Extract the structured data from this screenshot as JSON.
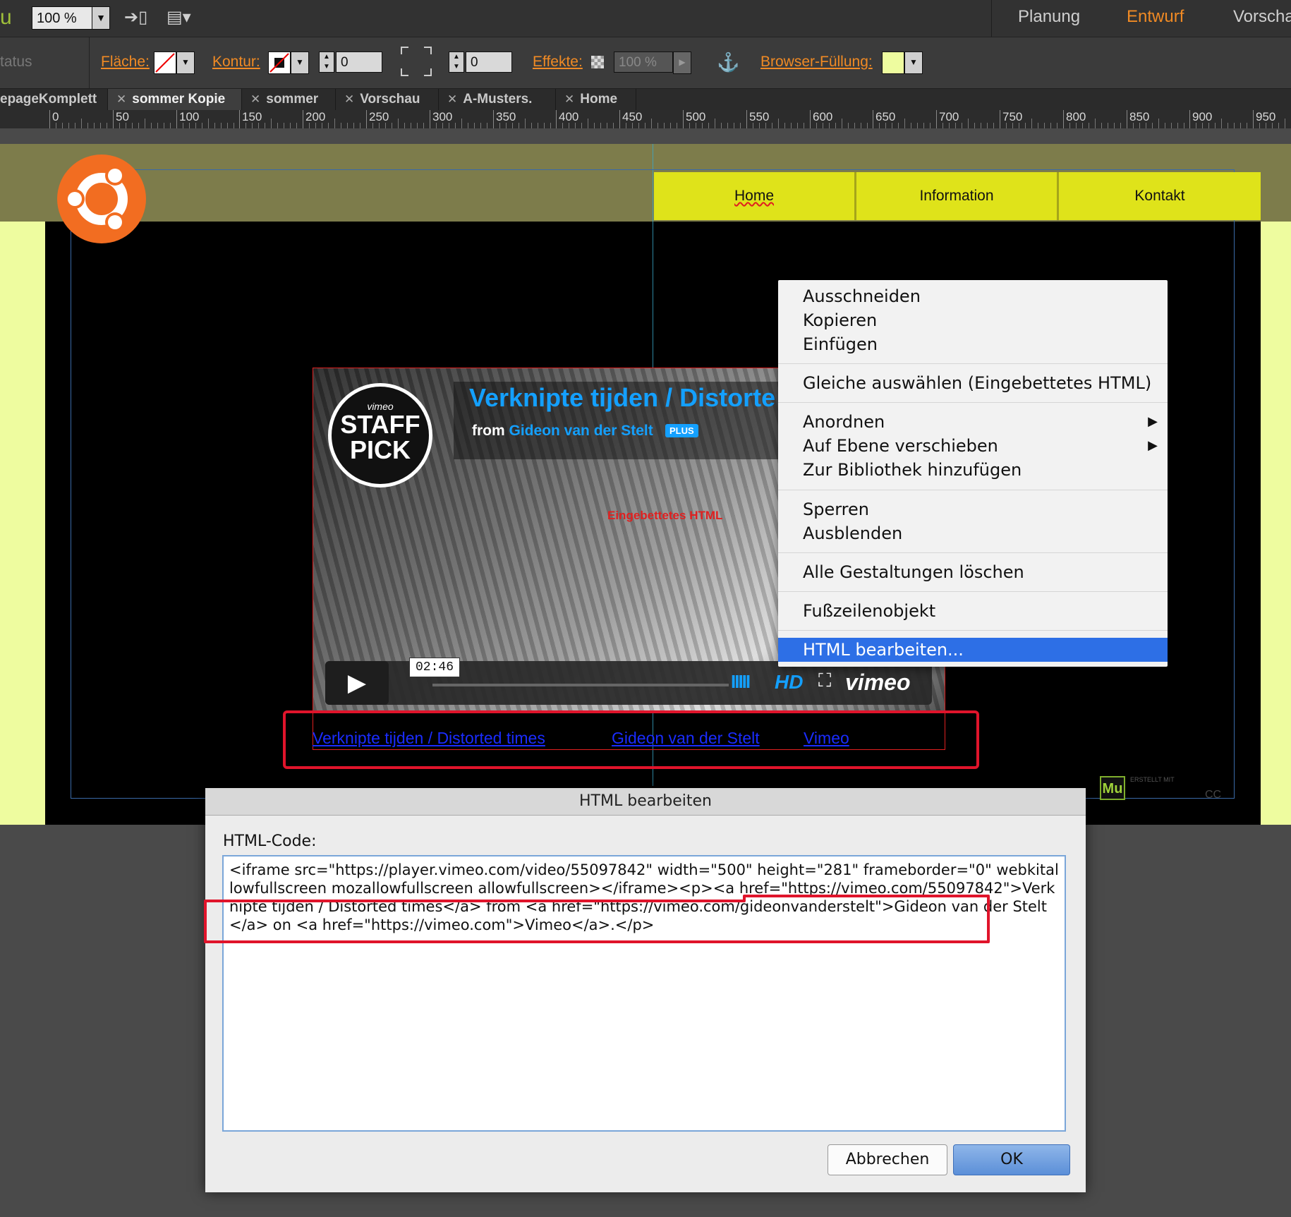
{
  "toolbar": {
    "zoom_value": "100 %",
    "modes": [
      "Planung",
      "Entwurf",
      "Vorscha"
    ],
    "active_mode": "Entwurf"
  },
  "controls": {
    "status_label": "tatus",
    "fill_label": "Fläche:",
    "stroke_label": "Kontur:",
    "stroke_width": "0",
    "corner_value": "0",
    "effects_label": "Effekte:",
    "opacity_value": "100 %",
    "browser_fill_label": "Browser-Füllung:",
    "browser_fill_color": "#eefc9f"
  },
  "tabs": [
    {
      "label": "epageKomplett",
      "closable": false
    },
    {
      "label": "sommer Kopie",
      "closable": true,
      "active": true
    },
    {
      "label": "sommer",
      "closable": true
    },
    {
      "label": "Vorschau",
      "closable": true
    },
    {
      "label": "A-Musters.",
      "closable": true
    },
    {
      "label": "Home",
      "closable": true
    }
  ],
  "ruler": [
    "0",
    "50",
    "100",
    "150",
    "200",
    "250",
    "300",
    "350",
    "400",
    "450",
    "500",
    "550",
    "600",
    "650",
    "700",
    "750",
    "800",
    "850",
    "900",
    "950"
  ],
  "site_nav": [
    "Home",
    "Information",
    "Kontakt"
  ],
  "video": {
    "badge_top": "vimeo",
    "badge_line1": "STAFF",
    "badge_line2": "PICK",
    "title": "Verknipte tijden / Distorte",
    "from_prefix": "from",
    "author": "Gideon van der Stelt",
    "plus_badge": "PLUS",
    "embed_label": "Eingebettetes HTML",
    "duration": "02:46",
    "hd_label": "HD",
    "brand": "vimeo"
  },
  "embed_links": {
    "title_link": "Verknipte tijden / Distorted times",
    "author_link": "Gideon van der Stelt",
    "site_link": "Vimeo"
  },
  "context_menu": {
    "items": [
      "Ausschneiden",
      "Kopieren",
      "Einfügen",
      "Gleiche auswählen (Eingebettetes HTML)",
      "Anordnen",
      "Auf Ebene verschieben",
      "Zur Bibliothek hinzufügen",
      "Sperren",
      "Ausblenden",
      "Alle Gestaltungen löschen",
      "Fußzeilenobjekt",
      "HTML bearbeiten..."
    ]
  },
  "dialog": {
    "title": "HTML bearbeiten",
    "label": "HTML-Code:",
    "code": "<iframe src=\"https://player.vimeo.com/video/55097842\" width=\"500\" height=\"281\" frameborder=\"0\" webkitallowfullscreen mozallowfullscreen allowfullscreen></iframe><p><a href=\"https://vimeo.com/55097842\">Verknipte tijden / Distorted times</a> from <a href=\"https://vimeo.com/gideonvanderstelt\">Gideon van der Stelt</a> on <a href=\"https://vimeo.com\">Vimeo</a>.</p>",
    "cancel_label": "Abbrechen",
    "ok_label": "OK"
  },
  "footer_badge": {
    "mu": "Mu",
    "cc": "CC",
    "made_with": "ERSTELLT MIT"
  },
  "colors": {
    "accent": "#f08a24",
    "nav_yellow": "#dfe31a",
    "header_olive": "#7d7c4b",
    "highlight_red": "#e0142b",
    "menu_selection": "#2d6fe6"
  }
}
